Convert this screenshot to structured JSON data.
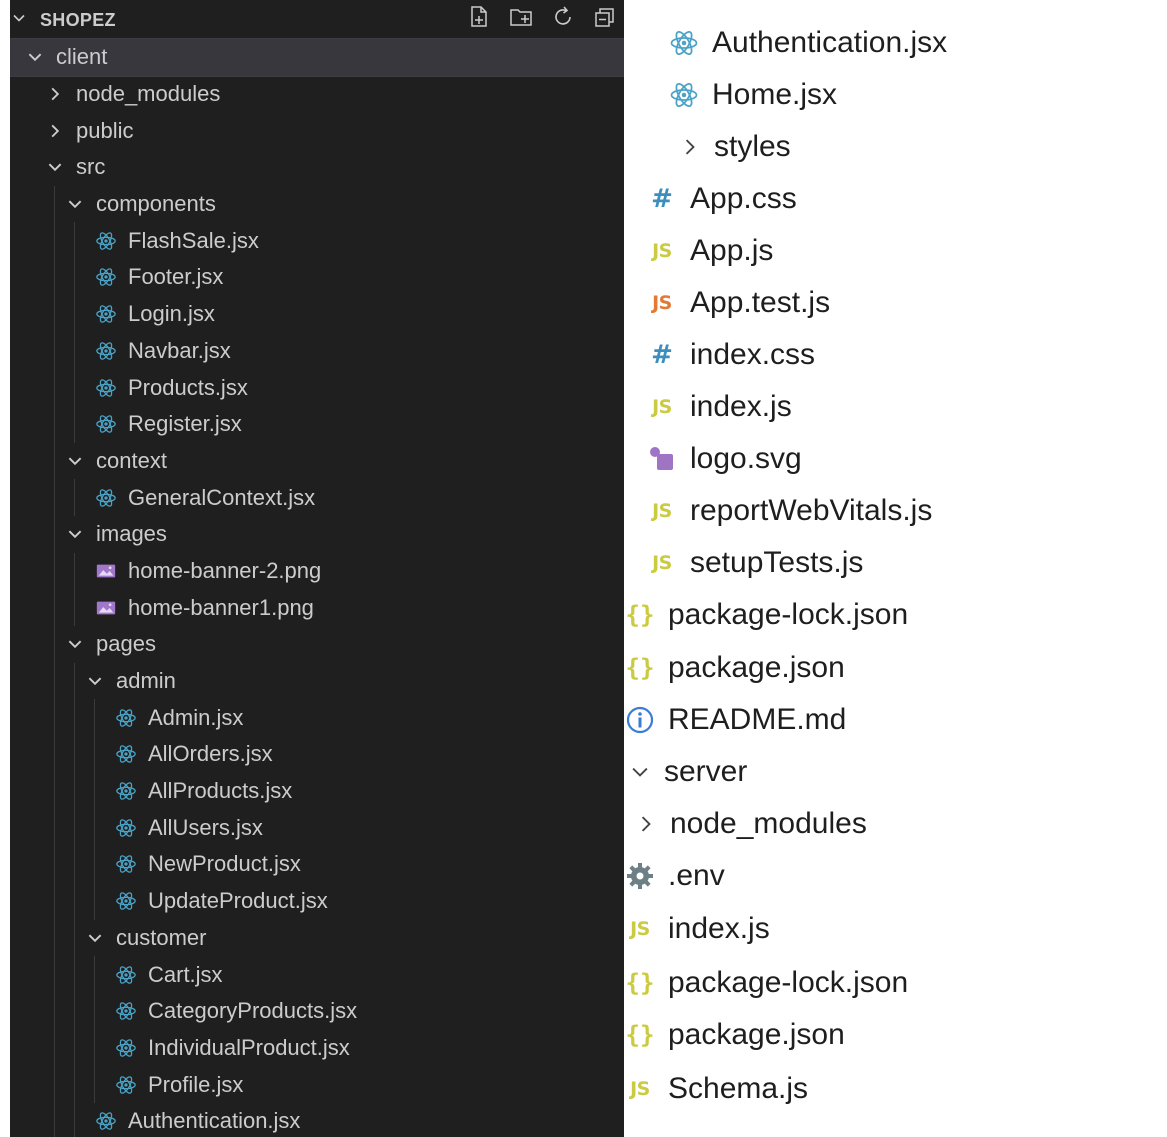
{
  "colors": {
    "left_bg": "#1f1f1f",
    "left_text": "#cccccc",
    "selected_row": "#37373d",
    "react_icon": "#4aa3c7",
    "image_icon": "#a178c9",
    "js_yellow": "#cbcb41",
    "js_test_orange": "#e37933",
    "css_hash": "#3c8fbd",
    "json_brace": "#cbcb41",
    "svg_icon": "#a074c4",
    "info_icon": "#3a7bd5",
    "gear_icon": "#6d8086"
  },
  "explorer": {
    "title": "SHOPEZ",
    "actions": [
      {
        "name": "new-file-icon",
        "label": "New File"
      },
      {
        "name": "new-folder-icon",
        "label": "New Folder"
      },
      {
        "name": "refresh-icon",
        "label": "Refresh Explorer"
      },
      {
        "name": "collapse-all-icon",
        "label": "Collapse Folders"
      }
    ]
  },
  "left_tree": [
    {
      "label": "client",
      "kind": "folder",
      "open": true,
      "depth": 0,
      "selected": true
    },
    {
      "label": "node_modules",
      "kind": "folder",
      "open": false,
      "depth": 1
    },
    {
      "label": "public",
      "kind": "folder",
      "open": false,
      "depth": 1
    },
    {
      "label": "src",
      "kind": "folder",
      "open": true,
      "depth": 1
    },
    {
      "label": "components",
      "kind": "folder",
      "open": true,
      "depth": 2
    },
    {
      "label": "FlashSale.jsx",
      "kind": "react",
      "depth": 3
    },
    {
      "label": "Footer.jsx",
      "kind": "react",
      "depth": 3
    },
    {
      "label": "Login.jsx",
      "kind": "react",
      "depth": 3
    },
    {
      "label": "Navbar.jsx",
      "kind": "react",
      "depth": 3
    },
    {
      "label": "Products.jsx",
      "kind": "react",
      "depth": 3
    },
    {
      "label": "Register.jsx",
      "kind": "react",
      "depth": 3
    },
    {
      "label": "context",
      "kind": "folder",
      "open": true,
      "depth": 2
    },
    {
      "label": "GeneralContext.jsx",
      "kind": "react",
      "depth": 3
    },
    {
      "label": "images",
      "kind": "folder",
      "open": true,
      "depth": 2
    },
    {
      "label": "home-banner-2.png",
      "kind": "image",
      "depth": 3
    },
    {
      "label": "home-banner1.png",
      "kind": "image",
      "depth": 3
    },
    {
      "label": "pages",
      "kind": "folder",
      "open": true,
      "depth": 2
    },
    {
      "label": "admin",
      "kind": "folder",
      "open": true,
      "depth": 3
    },
    {
      "label": "Admin.jsx",
      "kind": "react",
      "depth": 4
    },
    {
      "label": "AllOrders.jsx",
      "kind": "react",
      "depth": 4
    },
    {
      "label": "AllProducts.jsx",
      "kind": "react",
      "depth": 4
    },
    {
      "label": "AllUsers.jsx",
      "kind": "react",
      "depth": 4
    },
    {
      "label": "NewProduct.jsx",
      "kind": "react",
      "depth": 4
    },
    {
      "label": "UpdateProduct.jsx",
      "kind": "react",
      "depth": 4
    },
    {
      "label": "customer",
      "kind": "folder",
      "open": true,
      "depth": 3
    },
    {
      "label": "Cart.jsx",
      "kind": "react",
      "depth": 4
    },
    {
      "label": "CategoryProducts.jsx",
      "kind": "react",
      "depth": 4
    },
    {
      "label": "IndividualProduct.jsx",
      "kind": "react",
      "depth": 4
    },
    {
      "label": "Profile.jsx",
      "kind": "react",
      "depth": 4
    },
    {
      "label": "Authentication.jsx",
      "kind": "react",
      "depth": 3
    }
  ],
  "right_tree": [
    {
      "label": "Authentication.jsx",
      "kind": "react",
      "depth": 2
    },
    {
      "label": "Home.jsx",
      "kind": "react",
      "depth": 2
    },
    {
      "label": "styles",
      "kind": "folder",
      "open": false,
      "depth": 2
    },
    {
      "label": "App.css",
      "kind": "css",
      "depth": 1
    },
    {
      "label": "App.js",
      "kind": "js",
      "depth": 1
    },
    {
      "label": "App.test.js",
      "kind": "jstest",
      "depth": 1
    },
    {
      "label": "index.css",
      "kind": "css",
      "depth": 1
    },
    {
      "label": "index.js",
      "kind": "js",
      "depth": 1
    },
    {
      "label": "logo.svg",
      "kind": "svg",
      "depth": 1
    },
    {
      "label": "reportWebVitals.js",
      "kind": "js",
      "depth": 1
    },
    {
      "label": "setupTests.js",
      "kind": "js",
      "depth": 1
    },
    {
      "label": "package-lock.json",
      "kind": "json",
      "depth": 0
    },
    {
      "label": "package.json",
      "kind": "json",
      "depth": 0
    },
    {
      "label": "README.md",
      "kind": "info",
      "depth": 0
    },
    {
      "label": "server",
      "kind": "folder",
      "open": true,
      "depth": -1
    },
    {
      "label": "node_modules",
      "kind": "folder",
      "open": false,
      "depth": 0
    },
    {
      "label": ".env",
      "kind": "gear",
      "depth": 0
    },
    {
      "label": "index.js",
      "kind": "js",
      "depth": 0
    },
    {
      "label": "package-lock.json",
      "kind": "json",
      "depth": 0
    },
    {
      "label": "package.json",
      "kind": "json",
      "depth": 0
    },
    {
      "label": "Schema.js",
      "kind": "js",
      "depth": 0
    }
  ],
  "badges": {
    "js": "JS",
    "css": "#",
    "json": "{}"
  }
}
